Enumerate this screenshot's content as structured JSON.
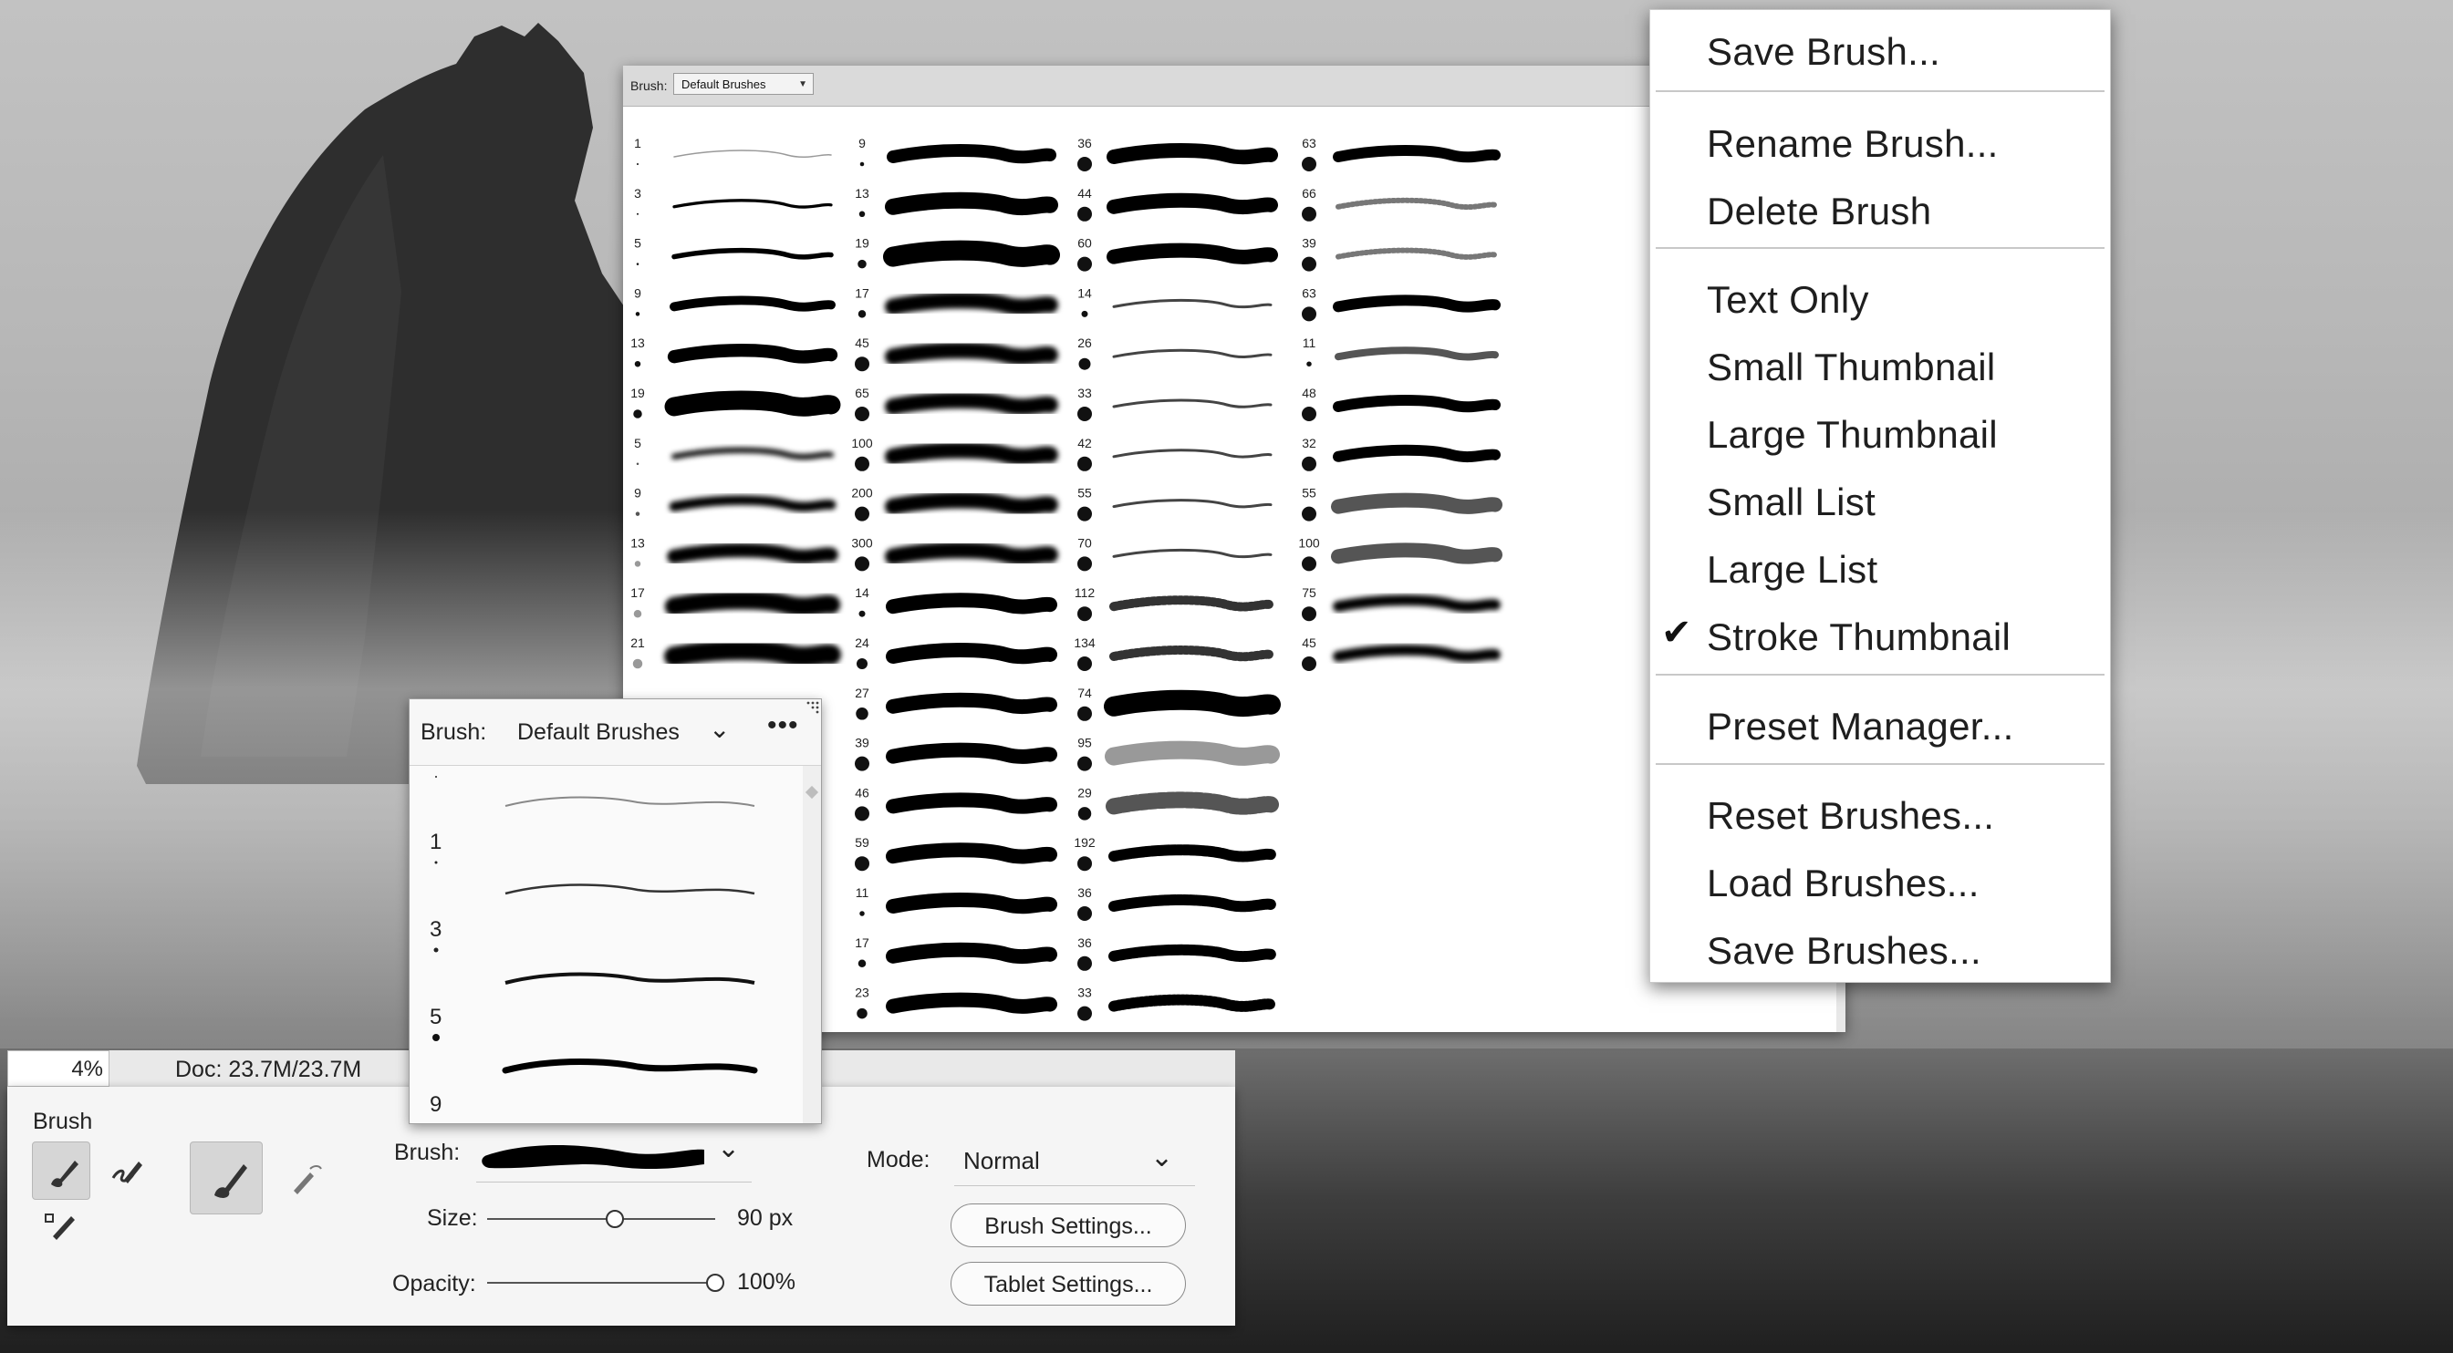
{
  "big_picker": {
    "label": "Brush:",
    "preset": "Default Brushes",
    "col1_sizes": [
      "1",
      "3",
      "5",
      "9",
      "13",
      "19",
      "5",
      "9",
      "13",
      "17",
      "21"
    ],
    "col2_sizes": [
      "9",
      "13",
      "19",
      "17",
      "45",
      "65",
      "100",
      "200",
      "300",
      "14",
      "24",
      "27",
      "39",
      "46",
      "59",
      "11",
      "17",
      "23"
    ],
    "col3_sizes": [
      "36",
      "44",
      "60",
      "14",
      "26",
      "33",
      "42",
      "55",
      "70",
      "112",
      "134",
      "74",
      "95",
      "29",
      "192",
      "36",
      "36",
      "33"
    ],
    "col4_sizes": [
      "63",
      "66",
      "39",
      "63",
      "11",
      "48",
      "32",
      "55",
      "100",
      "75",
      "45"
    ]
  },
  "menu": {
    "items": [
      {
        "label": "Save Brush..."
      },
      {
        "label": "Rename Brush..."
      },
      {
        "label": "Delete Brush"
      },
      {
        "label": "Text Only"
      },
      {
        "label": "Small Thumbnail"
      },
      {
        "label": "Large Thumbnail"
      },
      {
        "label": "Small List"
      },
      {
        "label": "Large List"
      },
      {
        "label": "Stroke Thumbnail",
        "checked": true
      },
      {
        "label": "Preset Manager..."
      },
      {
        "label": "Reset Brushes..."
      },
      {
        "label": "Load Brushes..."
      },
      {
        "label": "Save Brushes..."
      }
    ]
  },
  "small_picker": {
    "label": "Brush:",
    "preset": "Default Brushes",
    "more": "•••",
    "sizes": [
      "1",
      "3",
      "5",
      "9"
    ]
  },
  "status": {
    "zoom": "4%",
    "doc": "Doc: 23.7M/23.7M"
  },
  "options": {
    "title": "Brush",
    "brush_label": "Brush:",
    "size_label": "Size:",
    "size_value": "90 px",
    "size_fraction": 0.56,
    "opacity_label": "Opacity:",
    "opacity_value": "100%",
    "opacity_fraction": 1.0,
    "mode_label": "Mode:",
    "mode_value": "Normal",
    "brush_settings": "Brush Settings...",
    "tablet_settings": "Tablet Settings..."
  },
  "icons": {
    "more": "more-horizontal-icon",
    "chevron": "chevron-down-icon",
    "check": "checkmark-icon"
  }
}
